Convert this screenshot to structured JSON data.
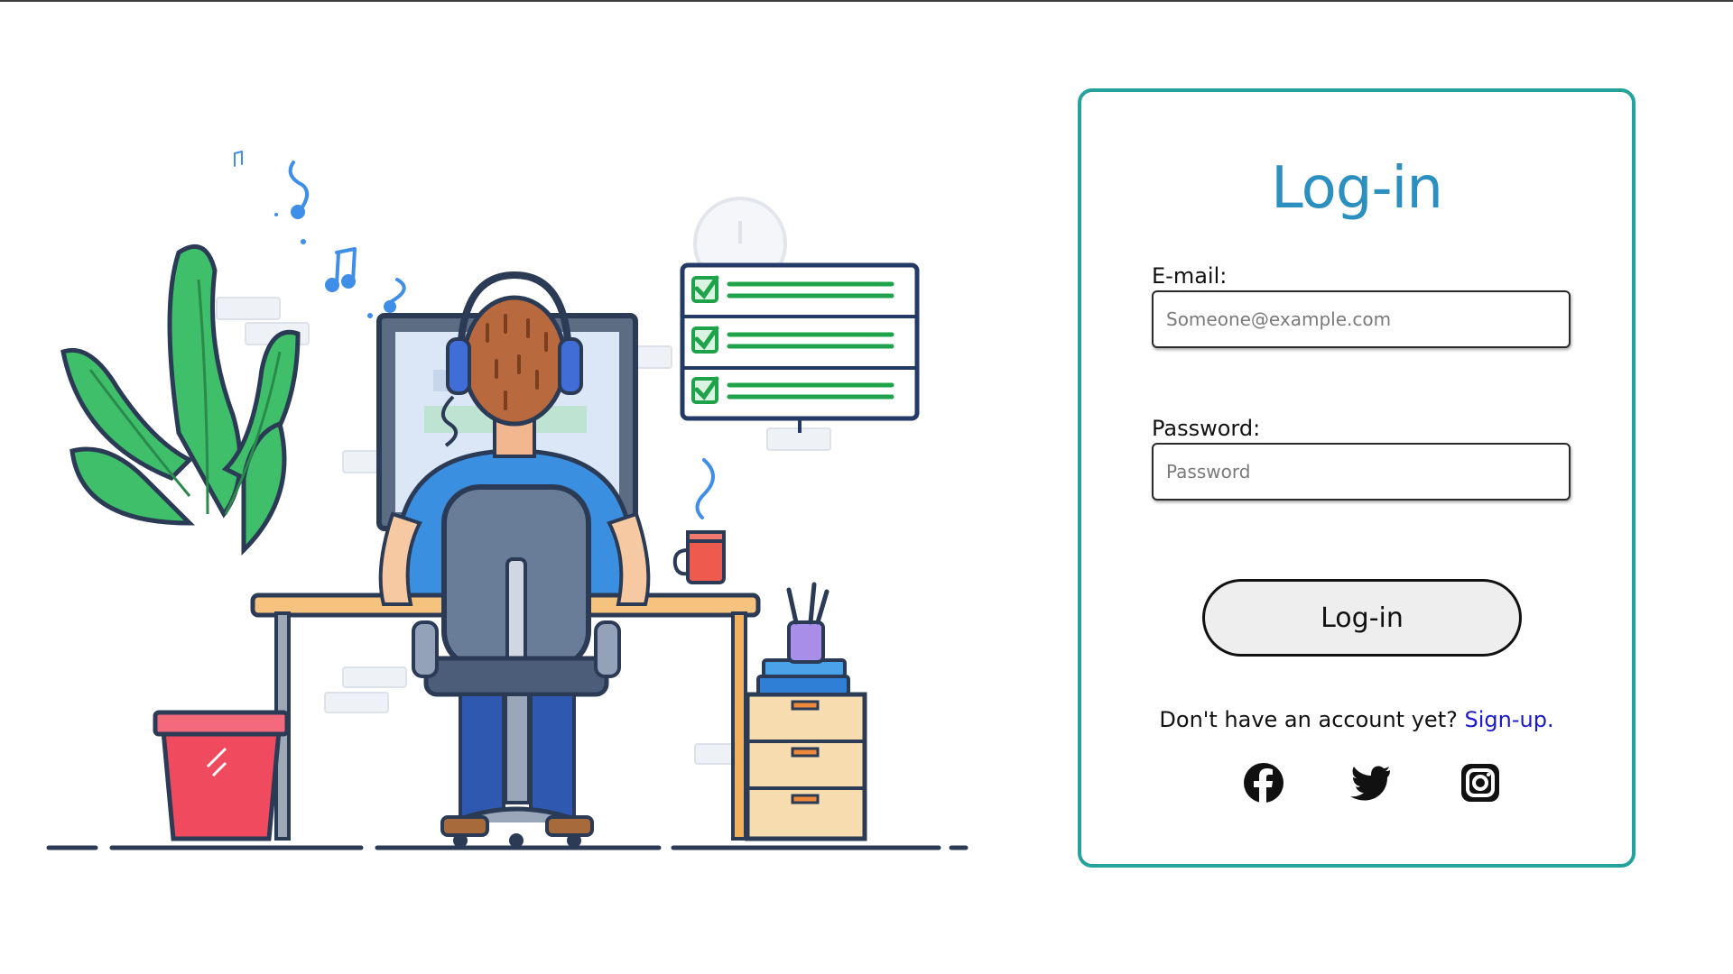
{
  "login": {
    "title": "Log-in",
    "email_label": "E-mail:",
    "email_placeholder": "Someone@example.com",
    "password_label": "Password:",
    "password_placeholder": "Password",
    "button_label": "Log-in",
    "signup_prompt": "Don't have an account yet?",
    "signup_link": "Sign-up."
  },
  "social": [
    "facebook-icon",
    "twitter-icon",
    "instagram-icon"
  ],
  "colors": {
    "card_border": "#23a39b",
    "title": "#2b8fbf",
    "link": "#1a1acb",
    "button_bg": "#eeeeee"
  }
}
